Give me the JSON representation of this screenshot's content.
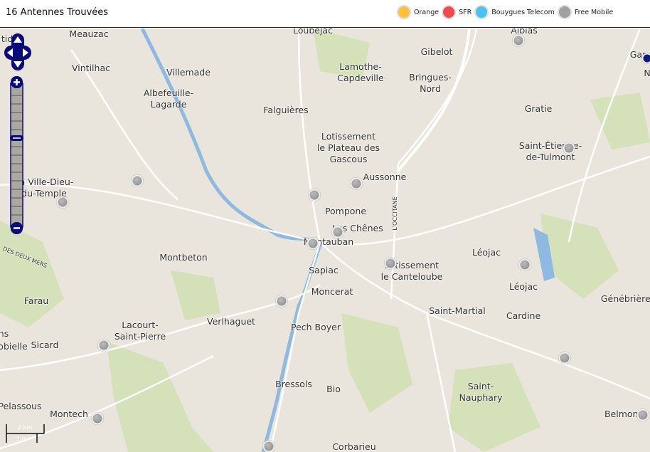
{
  "header": {
    "title": "16 Antennes Trouvées"
  },
  "legend": [
    {
      "label": "Orange",
      "color": "#ffc040"
    },
    {
      "label": "SFR",
      "color": "#f04a4a"
    },
    {
      "label": "Bouygues Telecom",
      "color": "#4ac3f0"
    },
    {
      "label": "Free Mobile",
      "color": "#a0a0a0"
    }
  ],
  "map": {
    "labels": [
      "Meauzac",
      "Loubejac",
      "Albias",
      "Vintilhac",
      "Villemade",
      "Lamothe-\nCapdeville",
      "Gibelot",
      "Bringues-\nNord",
      "Albefeuille-\nLagarde",
      "Falguières",
      "Gratie",
      "Lotissement\nle Plateau des\nGascous",
      "Saint-Étienne-\nde-Tulmont",
      "Aussonne",
      "La Ville-Dieu-\ndu-Temple",
      "Pompone",
      "Les Chênes",
      "Montauban",
      "L'OCCITANE",
      "Montbeton",
      "Léojac",
      "Lotissement\nle Canteloube",
      "Sapiac",
      "Léojac",
      "Moncerat",
      "Farau",
      "Saint-Martial",
      "Cardine",
      "Génébrières",
      "Verlhaguet",
      "Lacourt-\nSaint-Pierre",
      "Pech Boyer",
      "Sicard",
      "obielle",
      "Bressols",
      "Bio",
      "Saint-\nNauphary",
      "Pelassous",
      "Montech",
      "Belmonte",
      "Corbarieu",
      "DES DEUX MERS",
      "Gar",
      "N",
      "ns",
      "tid"
    ],
    "scale": {
      "km": "2 km",
      "mi": "1 mi"
    },
    "marker_count": 16
  }
}
